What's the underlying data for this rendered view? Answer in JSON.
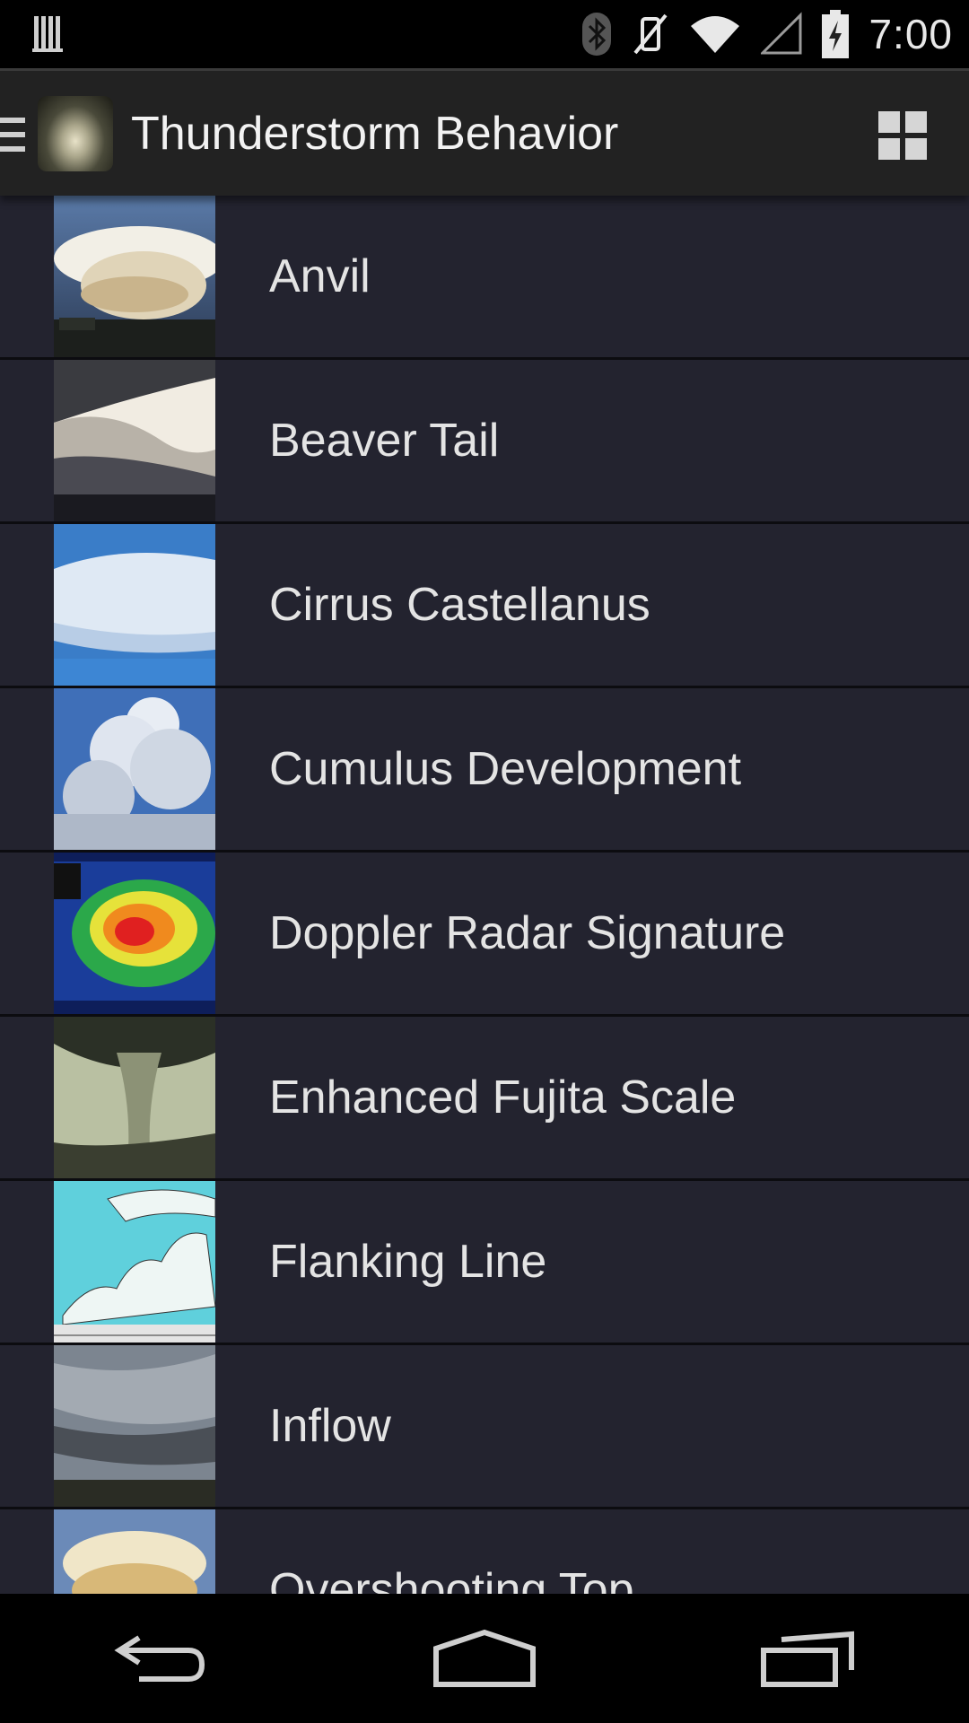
{
  "status_bar": {
    "time": "7:00"
  },
  "action_bar": {
    "title": "Thunderstorm Behavior"
  },
  "list": {
    "items": [
      {
        "label": "Anvil"
      },
      {
        "label": "Beaver Tail"
      },
      {
        "label": "Cirrus Castellanus"
      },
      {
        "label": "Cumulus Development"
      },
      {
        "label": "Doppler Radar Signature"
      },
      {
        "label": "Enhanced Fujita Scale"
      },
      {
        "label": "Flanking Line"
      },
      {
        "label": "Inflow"
      },
      {
        "label": "Overshooting Top"
      }
    ]
  },
  "icons": {
    "status": [
      "notification-bars-icon",
      "bluetooth-icon",
      "vibrate-mute-icon",
      "wifi-icon",
      "cell-signal-icon",
      "battery-charging-icon"
    ],
    "action_bar": [
      "drawer-indicator-icon",
      "app-icon",
      "grid-view-icon"
    ],
    "nav": [
      "back-icon",
      "home-icon",
      "recents-icon"
    ]
  },
  "colors": {
    "list_background": "#23232f",
    "action_bar": "#222222",
    "text": "#e4e4e4"
  }
}
